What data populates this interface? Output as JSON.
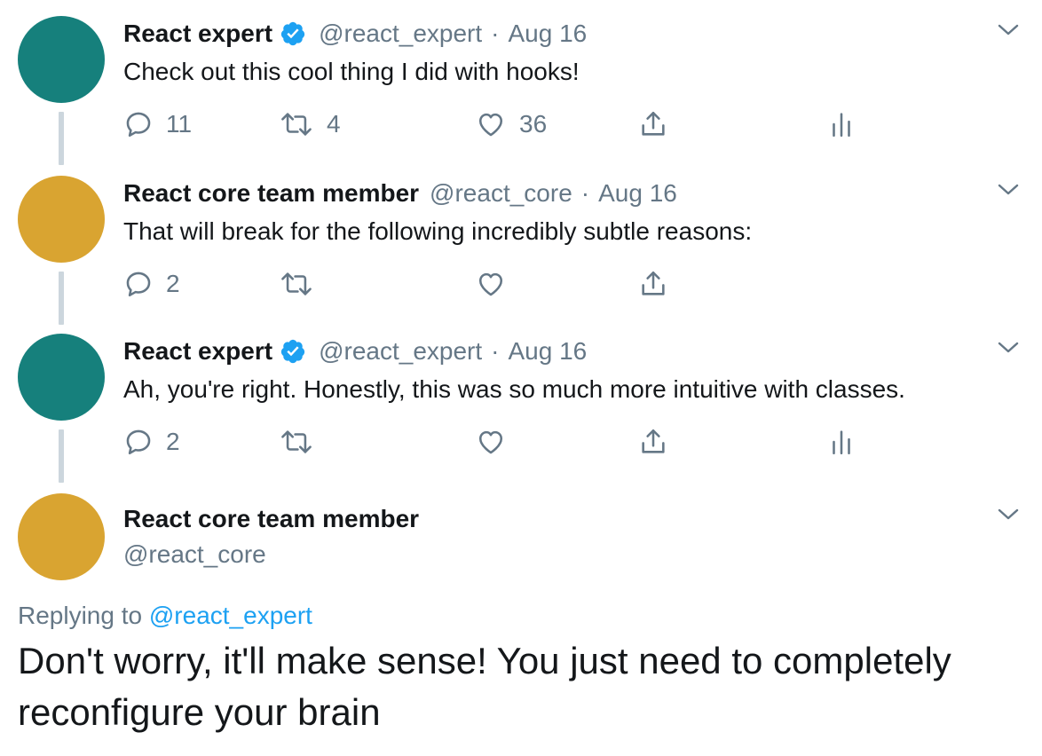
{
  "colors": {
    "avatar_expert": "#16807c",
    "avatar_core": "#d9a431",
    "verified": "#1da1f2",
    "link": "#1da1f2",
    "secondary_text": "#657786",
    "thread_line": "#ccd6dd"
  },
  "tweets": [
    {
      "name": "React expert",
      "verified": true,
      "handle": "@react_expert",
      "separator": "·",
      "date": "Aug 16",
      "text": "Check out this cool thing I did with hooks!",
      "replies": "11",
      "retweets": "4",
      "likes": "36",
      "icons": [
        "reply-icon",
        "retweet-icon",
        "like-icon",
        "share-icon",
        "analytics-icon",
        "chevron-down-icon"
      ]
    },
    {
      "name": "React core team member",
      "verified": false,
      "handle": "@react_core",
      "separator": "·",
      "date": "Aug 16",
      "text": "That will break for the following incredibly subtle reasons:",
      "replies": "2",
      "retweets": "",
      "likes": "",
      "icons": [
        "reply-icon",
        "retweet-icon",
        "like-icon",
        "share-icon",
        "chevron-down-icon"
      ]
    },
    {
      "name": "React expert",
      "verified": true,
      "handle": "@react_expert",
      "separator": "·",
      "date": "Aug 16",
      "text": "Ah, you're right. Honestly, this was so much more intuitive with classes.",
      "replies": "2",
      "retweets": "",
      "likes": "",
      "icons": [
        "reply-icon",
        "retweet-icon",
        "like-icon",
        "share-icon",
        "analytics-icon",
        "chevron-down-icon"
      ]
    }
  ],
  "main_tweet": {
    "name": "React core team member",
    "handle": "@react_core",
    "replying_prefix": "Replying to",
    "replying_to": "@react_expert",
    "text": "Don't worry, it'll make sense! You just need to completely reconfigure your brain"
  }
}
